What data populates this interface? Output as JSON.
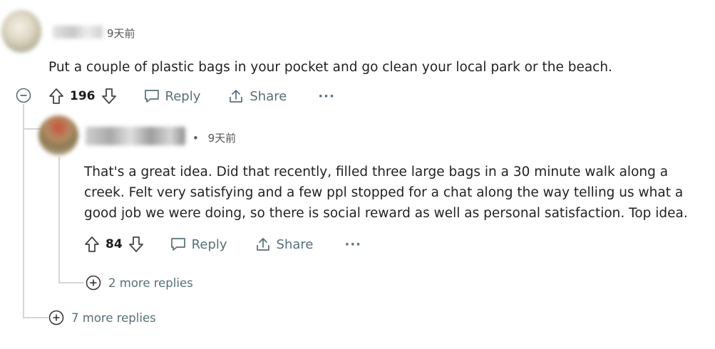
{
  "comment": {
    "time": "9天前",
    "body": "Put a couple of plastic bags in your pocket and go clean your local park or the beach.",
    "score": "196",
    "reply_label": "Reply",
    "share_label": "Share",
    "more_label": "···",
    "more_replies": "7 more replies"
  },
  "reply": {
    "separator": "•",
    "time": "9天前",
    "body_lines": [
      "That's a great idea. Did that recently, filled three large bags in a 30 minute walk along a",
      "creek. Felt very satisfying and a few ppl stopped for a chat along the way telling us what a",
      "good job we were doing, so there is social reward as well as personal satisfaction. Top idea."
    ],
    "score": "84",
    "reply_label": "Reply",
    "share_label": "Share",
    "more_label": "···",
    "more_replies": "2 more replies"
  }
}
